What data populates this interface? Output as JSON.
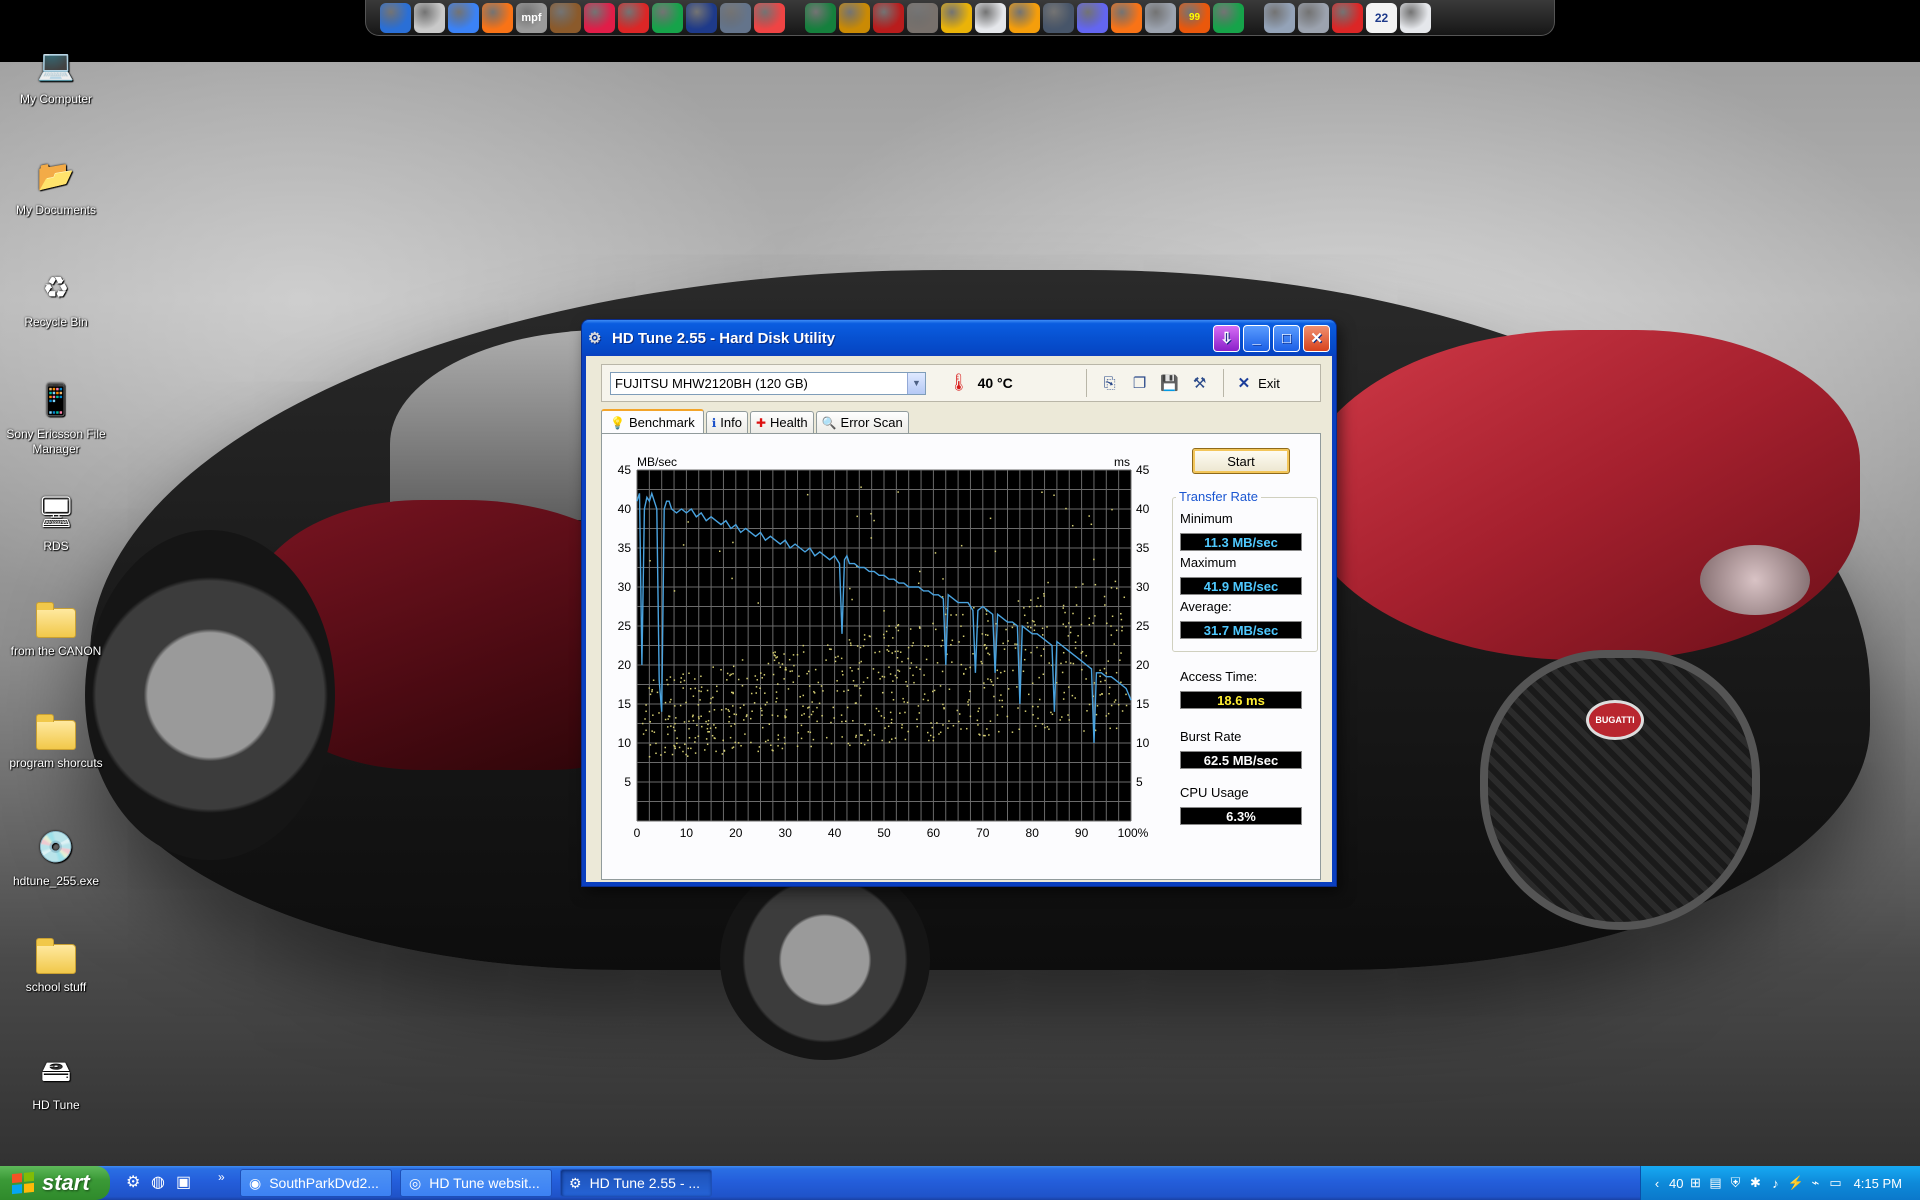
{
  "desktop": {
    "icons": [
      {
        "label": "My Computer",
        "glyph": "💻"
      },
      {
        "label": "My Documents",
        "glyph": "📂"
      },
      {
        "label": "Recycle Bin",
        "glyph": "♻"
      },
      {
        "label": "Sony Ericsson File Manager",
        "glyph": "📱"
      },
      {
        "label": "RDS",
        "glyph": "🖥"
      },
      {
        "label": "from the CANON",
        "glyph": "folder"
      },
      {
        "label": "program shorcuts",
        "glyph": "folder"
      },
      {
        "label": "hdtune_255.exe",
        "glyph": "💿"
      },
      {
        "label": "school stuff",
        "glyph": "folder"
      },
      {
        "label": "HD Tune",
        "glyph": "🖴"
      }
    ],
    "wallpaper_badge": "BUGATTI"
  },
  "dock": {
    "icons": [
      "explorer-icon",
      "notepad-icon",
      "firefox-icon",
      "orange-ball-icon",
      "mpf-icon",
      "snail-icon",
      "smiley-icon",
      "flag-icon",
      "settings-icon",
      "monitor-icon",
      "network-icon",
      "ring-icon",
      "sep",
      "card-icon",
      "triforce-icon",
      "bug-icon",
      "microphone-icon",
      "half-life-icon",
      "window-icon",
      "half-life-icon-2",
      "shield-icon",
      "pinwheel-icon",
      "bell-icon",
      "gear-flower-icon",
      "chart-icon",
      "display-icon",
      "sep",
      "gear-icon",
      "red-app-icon",
      "people-icon",
      "calendar-icon",
      "drive-icon"
    ],
    "calendar_day": "22",
    "mpf_label": "mpf",
    "badge_99": "99"
  },
  "window": {
    "title": "HD Tune 2.55 - Hard Disk Utility",
    "drive": "FUJITSU MHW2120BH (120 GB)",
    "temperature": "40 °C",
    "exit_label": "Exit",
    "tabs": [
      {
        "label": "Benchmark",
        "icon": "bulb-icon",
        "glyph": "💡"
      },
      {
        "label": "Info",
        "icon": "info-icon",
        "glyph": "ℹ"
      },
      {
        "label": "Health",
        "icon": "health-cross-icon",
        "glyph": "✚"
      },
      {
        "label": "Error Scan",
        "icon": "magnifier-icon",
        "glyph": "🔍"
      }
    ],
    "start_label": "Start",
    "transfer_rate_title": "Transfer Rate",
    "minimum_label": "Minimum",
    "minimum_value": "11.3 MB/sec",
    "maximum_label": "Maximum",
    "maximum_value": "41.9 MB/sec",
    "average_label": "Average:",
    "average_value": "31.7 MB/sec",
    "access_time_label": "Access Time:",
    "access_time_value": "18.6 ms",
    "burst_rate_label": "Burst Rate",
    "burst_rate_value": "62.5 MB/sec",
    "cpu_usage_label": "CPU Usage",
    "cpu_usage_value": "6.3%"
  },
  "chart_data": {
    "type": "line",
    "ylabel_left": "MB/sec",
    "ylabel_right": "ms",
    "ylim": [
      0,
      45
    ],
    "xlim": [
      0,
      100
    ],
    "x_ticks": [
      "0",
      "10",
      "20",
      "30",
      "40",
      "50",
      "60",
      "70",
      "80",
      "90",
      "100%"
    ],
    "y_ticks_left": [
      "5",
      "10",
      "15",
      "20",
      "25",
      "30",
      "35",
      "40",
      "45"
    ],
    "y_ticks_right": [
      "5",
      "10",
      "15",
      "20",
      "25",
      "30",
      "35",
      "40",
      "45"
    ],
    "grid": true,
    "series": [
      {
        "line_color": "#4aa3df",
        "x": [
          0,
          0.5,
          1,
          1.5,
          2,
          2.5,
          3,
          3.5,
          4,
          4.5,
          5,
          5.5,
          6,
          6.5,
          7,
          8,
          9,
          10,
          11,
          12,
          13,
          14,
          15,
          16,
          17,
          18,
          19,
          20,
          21,
          22,
          23,
          24,
          25,
          26,
          27,
          28,
          29,
          30,
          31,
          32,
          33,
          34,
          35,
          36,
          37,
          38,
          39,
          40,
          41,
          41.5,
          42,
          42.5,
          43,
          44,
          45,
          46,
          47,
          48,
          49,
          50,
          51,
          52,
          53,
          54,
          55,
          56,
          57,
          58,
          59,
          60,
          61,
          62,
          62.5,
          63,
          64,
          65,
          66,
          67,
          68,
          68.5,
          69,
          70,
          71,
          72,
          72.5,
          73,
          74,
          75,
          76,
          77,
          77.5,
          78,
          79,
          80,
          81,
          82,
          83,
          84,
          84.5,
          85,
          86,
          87,
          88,
          89,
          90,
          91,
          92,
          92.5,
          93,
          94,
          95,
          96,
          97,
          98,
          99,
          100
        ],
        "values": [
          41,
          42,
          20,
          40,
          41.5,
          41,
          42,
          41,
          40,
          18,
          14,
          40,
          41,
          41,
          40,
          39.5,
          40,
          39.5,
          40,
          39,
          39.5,
          38.5,
          39,
          38.5,
          38,
          38.5,
          37.5,
          38,
          37,
          37.5,
          37,
          36.5,
          37,
          36,
          36.5,
          36,
          35.5,
          36,
          35,
          35.5,
          35,
          34.5,
          35,
          34,
          34.5,
          34,
          33.5,
          34,
          33,
          24,
          33.5,
          34,
          33,
          33,
          32.5,
          32.5,
          32,
          32,
          31.5,
          31.5,
          31,
          31,
          30.5,
          30.5,
          30,
          30,
          30,
          29.5,
          29.5,
          29,
          29,
          28.5,
          20,
          29,
          28.5,
          28,
          28,
          28,
          27,
          19,
          27,
          27.5,
          27,
          26.5,
          19,
          26.5,
          26,
          25.5,
          25.5,
          25,
          15,
          25,
          24.5,
          24,
          24,
          23.5,
          23,
          22.5,
          14,
          23,
          22.5,
          22,
          21.5,
          21,
          20.5,
          20,
          19.5,
          10,
          19,
          19,
          18.5,
          18.5,
          18,
          17.5,
          17,
          15.5
        ]
      }
    ],
    "access_time_points": {
      "color": "#d6cf73",
      "unit": "ms",
      "count": 700,
      "min": 5,
      "max": 28,
      "note": ""
    }
  },
  "taskbar": {
    "start_label": "start",
    "tasks": [
      {
        "label": "SouthParkDvd2...",
        "icon": "disc-icon",
        "glyph": "◉"
      },
      {
        "label": "HD Tune websit...",
        "icon": "browser-icon",
        "glyph": "◎"
      },
      {
        "label": "HD Tune 2.55 - ...",
        "icon": "hdtune-icon",
        "glyph": "⚙"
      }
    ],
    "quicklaunch": [
      "settings-icon",
      "firefox-icon",
      "app-icon"
    ],
    "tray_temp": "40",
    "clock": "4:15 PM"
  },
  "colors": {
    "xp_blue": "#0a3fbf",
    "chart_bg": "#000000",
    "chart_grid": "#6a6a6a",
    "transfer_line": "#4aa3df",
    "access_dots": "#d6cf73",
    "value_blue": "#4fc9ff",
    "value_yellow": "#ffee33"
  }
}
